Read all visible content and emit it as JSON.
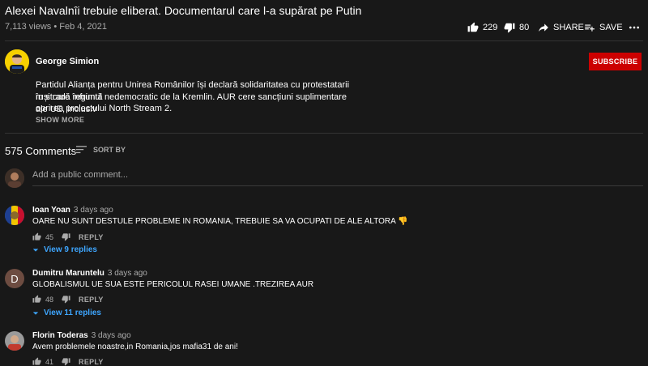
{
  "video": {
    "title": "Alexei Navalnîi trebuie eliberat. Documentarul care l-a supărat pe Putin",
    "meta": "7,113 views • Feb 4, 2021",
    "likes": "229",
    "dislikes": "80",
    "share_label": "SHARE",
    "save_label": "SAVE"
  },
  "channel": {
    "name": "George Simion",
    "subscribe_label": "SUBSCRIBE",
    "description_lines": [
      "Partidul Alianța pentru Unirea Românilor își declară solidaritatea cu protestatarii ruși care înfruntă",
      "în stradă regimul nedemocratic de la Kremlin. AUR cere sancțiuni suplimentare ale UE, inclusiv",
      "oprirea proiectului North Stream 2."
    ],
    "show_more_label": "SHOW MORE"
  },
  "comments_header": {
    "count": "575 Comments",
    "sort_label": "SORT BY",
    "add_placeholder": "Add a public comment..."
  },
  "comments": [
    {
      "author": "Ioan Yoan",
      "ago": "3 days ago",
      "text": "OARE NU SUNT DESTULE PROBLEME IN ROMANIA, TREBUIE SA VA OCUPATI DE ALE ALTORA 👎",
      "likes": "45",
      "reply_label": "REPLY",
      "replies_label": "View 9 replies",
      "avatar_color": "#2f5fb3"
    },
    {
      "author": "Dumitru Maruntelu",
      "ago": "3 days ago",
      "text": "GLOBALISMUL UE SUA ESTE PERICOLUL RASEI UMANE .TREZIREA AUR",
      "likes": "48",
      "reply_label": "REPLY",
      "replies_label": "View 11 replies",
      "avatar_letter": "D",
      "avatar_color": "#6d4c41"
    },
    {
      "author": "Florin Toderas",
      "ago": "3 days ago",
      "text": "Avem problemele noastre,in Romania,jos mafia31 de ani!",
      "likes": "41",
      "reply_label": "REPLY",
      "avatar_color": "#8a8a8a"
    }
  ]
}
